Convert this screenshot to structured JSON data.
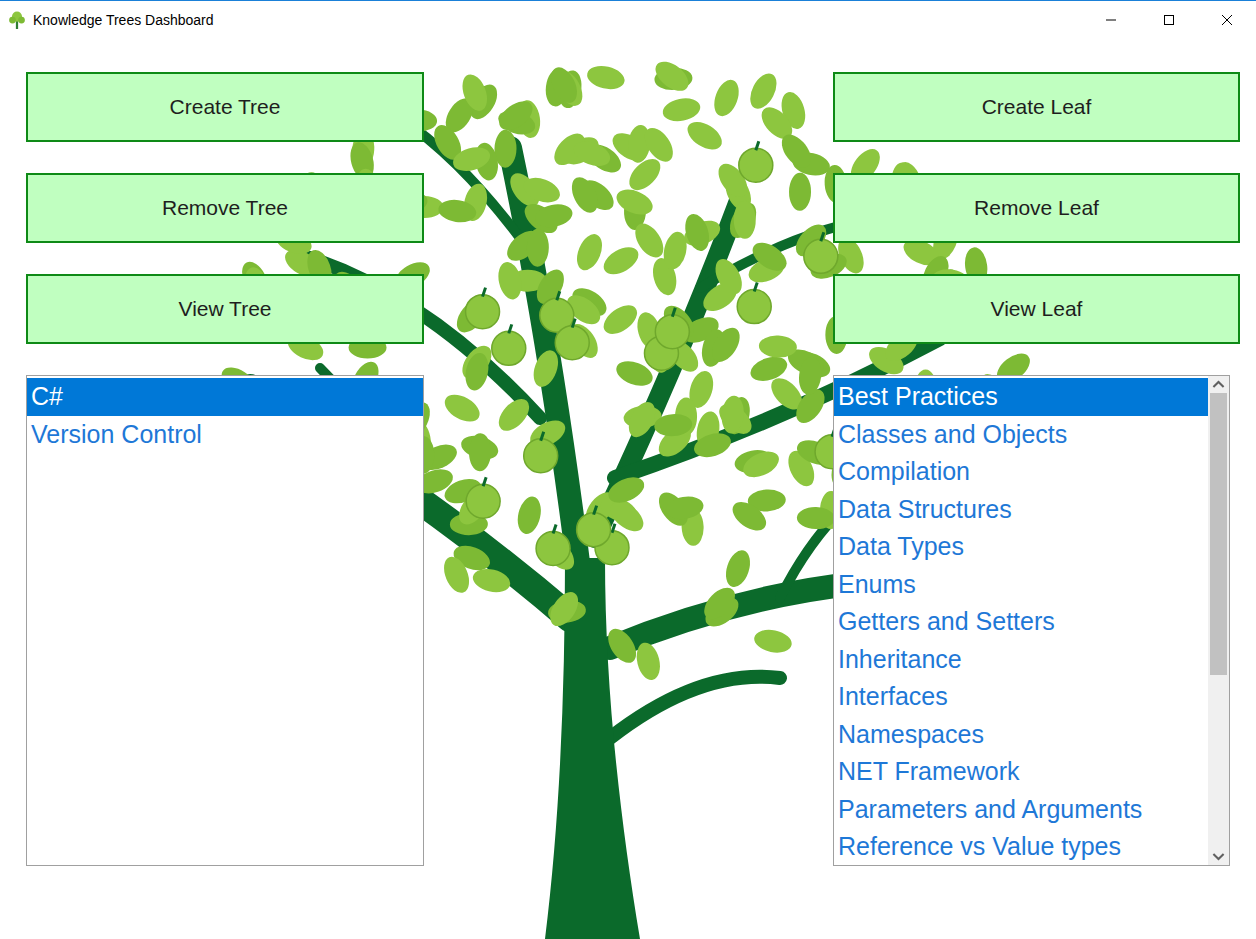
{
  "window": {
    "title": "Knowledge Trees Dashboard"
  },
  "tree_buttons": [
    "Create Tree",
    "Remove Tree",
    "View Tree"
  ],
  "leaf_buttons": [
    "Create Leaf",
    "Remove Leaf",
    "View Leaf"
  ],
  "trees": [
    {
      "label": "C#",
      "selected": true
    },
    {
      "label": "Version Control",
      "selected": false
    }
  ],
  "leaves": [
    {
      "label": "Best Practices",
      "selected": true
    },
    {
      "label": "Classes and Objects",
      "selected": false
    },
    {
      "label": "Compilation",
      "selected": false
    },
    {
      "label": "Data Structures",
      "selected": false
    },
    {
      "label": "Data Types",
      "selected": false
    },
    {
      "label": "Enums",
      "selected": false
    },
    {
      "label": "Getters and Setters",
      "selected": false
    },
    {
      "label": "Inheritance",
      "selected": false
    },
    {
      "label": "Interfaces",
      "selected": false
    },
    {
      "label": "Namespaces",
      "selected": false
    },
    {
      "label": "NET Framework",
      "selected": false
    },
    {
      "label": "Parameters and Arguments",
      "selected": false
    },
    {
      "label": "Reference vs Value types",
      "selected": false
    }
  ],
  "leaves_scrollbar": {
    "level": 0.62
  }
}
